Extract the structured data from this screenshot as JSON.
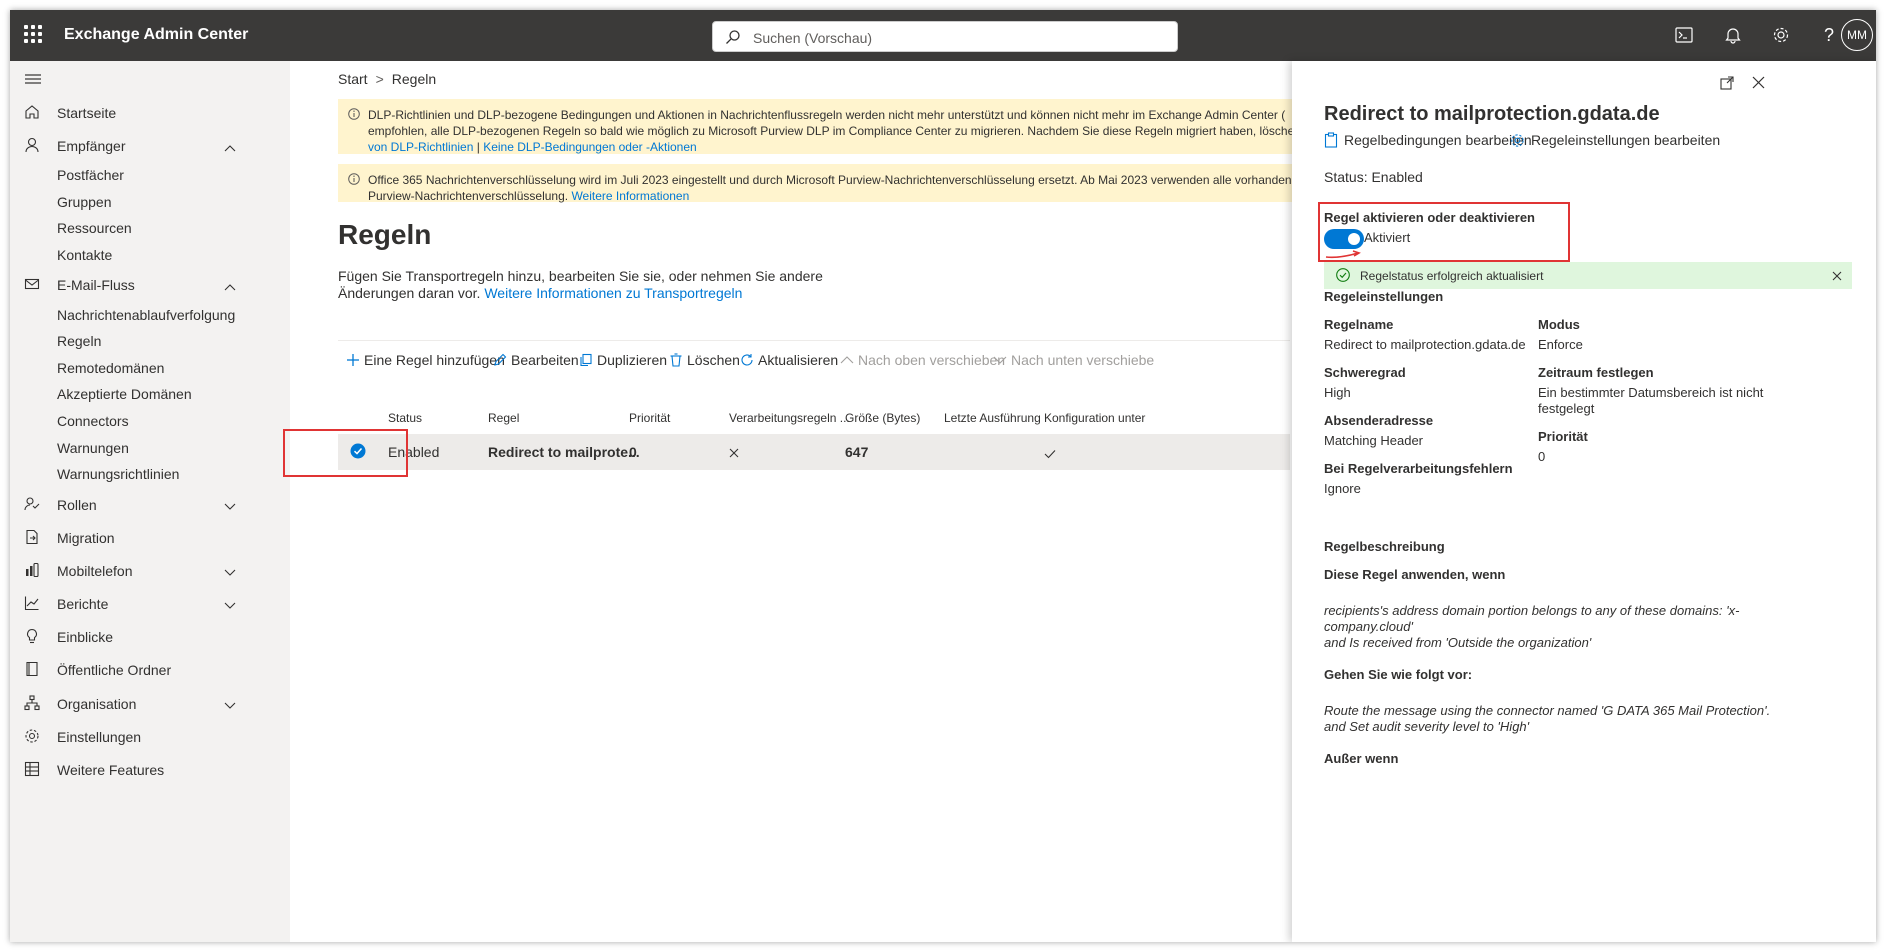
{
  "app": {
    "title": "Exchange Admin Center"
  },
  "search": {
    "placeholder": "Suchen (Vorschau)"
  },
  "user": {
    "initials": "MM"
  },
  "sidebar": {
    "items": [
      {
        "label": "Startseite"
      },
      {
        "label": "Empfänger"
      },
      {
        "label": "E-Mail-Fluss"
      },
      {
        "label": "Rollen"
      },
      {
        "label": "Migration"
      },
      {
        "label": "Mobiltelefon"
      },
      {
        "label": "Berichte"
      },
      {
        "label": "Einblicke"
      },
      {
        "label": "Öffentliche Ordner"
      },
      {
        "label": "Organisation"
      },
      {
        "label": "Einstellungen"
      },
      {
        "label": "Weitere Features"
      }
    ],
    "recipients_sub": [
      "Postfächer",
      "Gruppen",
      "Ressourcen",
      "Kontakte"
    ],
    "mailflow_sub": [
      "Nachrichtenablaufverfolgung",
      "Regeln",
      "Remotedomänen",
      "Akzeptierte Domänen",
      "Connectors",
      "Warnungen",
      "Warnungsrichtlinien"
    ]
  },
  "breadcrumb": {
    "home": "Start",
    "current": "Regeln"
  },
  "banners": {
    "dlp_text": "DLP-Richtlinien und DLP-bezogene Bedingungen und Aktionen in Nachrichtenflussregeln werden nicht mehr unterstützt und können nicht mehr im Exchange Admin Center (",
    "dlp_text2": "empfohlen, alle DLP-bezogenen Regeln so bald wie möglich zu Microsoft Purview DLP im Compliance Center zu migrieren. Nachdem Sie diese Regeln migriert haben, löscher",
    "dlp_link1": "von DLP-Richtlinien",
    "dlp_link_sep": "|",
    "dlp_link2": "Keine DLP-Bedingungen oder -Aktionen",
    "ome_text": "Office 365 Nachrichtenverschlüsselung wird im Juli 2023 eingestellt und durch Microsoft Purview-Nachrichtenverschlüsselung ersetzt. Ab Mai 2023 verwenden alle vorhanden",
    "ome_text2": "Purview-Nachrichtenverschlüsselung.",
    "ome_link": "Weitere Informationen"
  },
  "page": {
    "title": "Regeln",
    "description": "Fügen Sie Transportregeln hinzu, bearbeiten Sie sie, oder nehmen Sie andere Änderungen daran vor.",
    "description_link": "Weitere Informationen zu Transportregeln"
  },
  "toolbar": {
    "add": "Eine Regel hinzufügen",
    "edit": "Bearbeiten",
    "duplicate": "Duplizieren",
    "delete": "Löschen",
    "refresh": "Aktualisieren",
    "move_up": "Nach oben verschieben",
    "move_down": "Nach unten verschiebe"
  },
  "table": {
    "headers": [
      "Status",
      "Regel",
      "Priorität",
      "Verarbeitungsregeln ...",
      "Größe (Bytes)",
      "Letzte Ausführung",
      "Konfiguration unter"
    ],
    "rows": [
      {
        "status": "Enabled",
        "rule": "Redirect to mailprote...",
        "priority": "0",
        "size": "647"
      }
    ]
  },
  "panel": {
    "title": "Redirect to mailprotection.gdata.de",
    "edit_conditions": "Regelbedingungen bearbeiten",
    "edit_settings": "Regeleinstellungen bearbeiten",
    "status": "Status: Enabled",
    "toggle_label": "Regel aktivieren oder deaktivieren",
    "toggle_state": "Aktiviert",
    "success_msg": "Regelstatus erfolgreich aktualisiert",
    "settings_heading": "Regeleinstellungen",
    "rule_name_label": "Regelname",
    "rule_name_value": "Redirect to mailprotection.gdata.de",
    "mode_label": "Modus",
    "mode_value": "Enforce",
    "severity_label": "Schweregrad",
    "severity_value": "High",
    "timeframe_label": "Zeitraum festlegen",
    "timeframe_value1": "Ein bestimmter Datumsbereich ist nicht",
    "timeframe_value2": "festgelegt",
    "sender_label": "Absenderadresse",
    "sender_value": "Matching Header",
    "priority_label": "Priorität",
    "priority_value": "0",
    "error_label": "Bei Regelverarbeitungsfehlern",
    "error_value": "Ignore",
    "description_heading": "Regelbeschreibung",
    "apply_when": "Diese Regel anwenden, wenn",
    "cond1": "recipients's address domain portion belongs to any of these domains: 'x-",
    "cond2": "company.cloud'",
    "cond3": "and Is received from 'Outside the organization'",
    "do_heading": "Gehen Sie wie folgt vor:",
    "act1": "Route the message using the connector named 'G DATA 365 Mail Protection'.",
    "act2": "and Set audit severity level to 'High'",
    "except_heading": "Außer wenn"
  },
  "colors": {
    "accent": "#0078d4",
    "topbar": "#3b3a39",
    "highlight": "#e03434",
    "banner": "#fff4ce",
    "success": "#dff6dd"
  }
}
